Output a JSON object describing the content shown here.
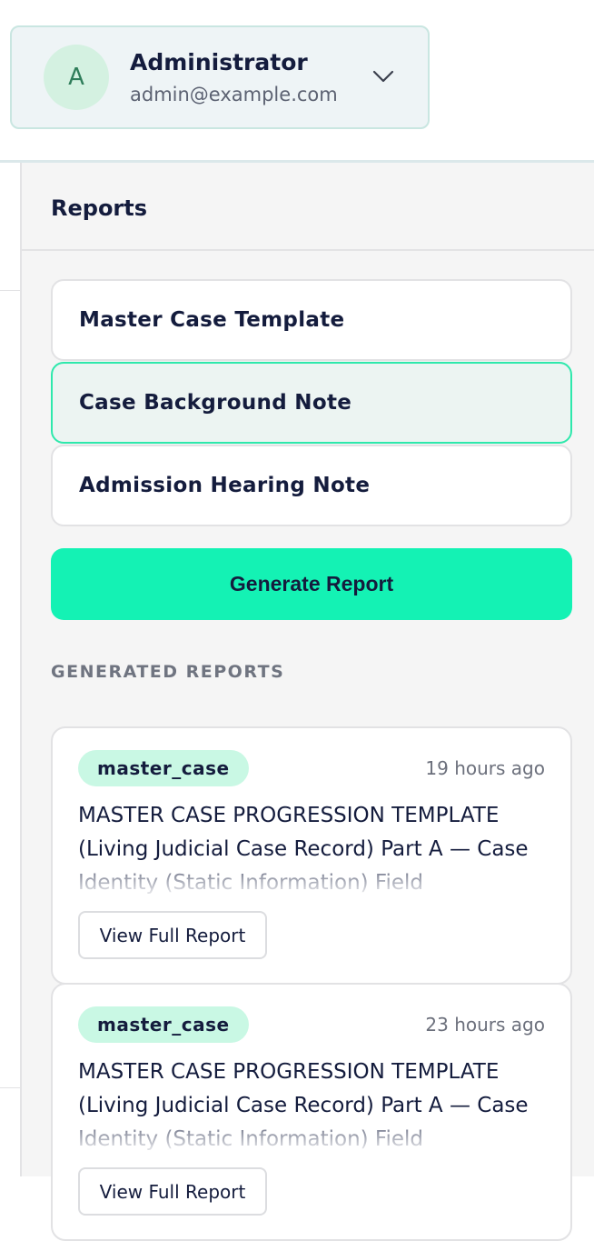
{
  "user": {
    "avatar_initial": "A",
    "name": "Administrator",
    "email": "admin@example.com"
  },
  "panel": {
    "title": "Reports",
    "templates": [
      {
        "label": "Master Case Template",
        "selected": false
      },
      {
        "label": "Case Background Note",
        "selected": true
      },
      {
        "label": "Admission Hearing Note",
        "selected": false
      }
    ],
    "generate_label": "Generate Report",
    "section_label": "GENERATED REPORTS",
    "reports": [
      {
        "tag": "master_case",
        "time": "19 hours ago",
        "excerpt": "MASTER CASE PROGRESSION TEMPLATE (Living Judicial Case Record) Part A — Case Identity (Static Information) Field",
        "view_label": "View Full Report"
      },
      {
        "tag": "master_case",
        "time": "23 hours ago",
        "excerpt": "MASTER CASE PROGRESSION TEMPLATE (Living Judicial Case Record) Part A — Case Identity (Static Information) Field",
        "view_label": "View Full Report"
      }
    ]
  },
  "colors": {
    "accent": "#14f2b4",
    "badge_bg": "#c9f8e4",
    "selected_bg": "#ecf4f2",
    "text": "#141c3d",
    "panel_bg": "#f5f5f5"
  }
}
